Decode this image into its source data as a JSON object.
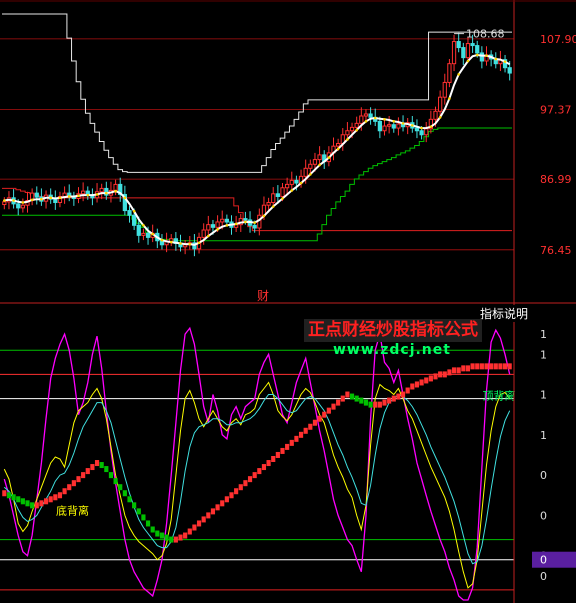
{
  "chart_data": [
    {
      "type": "line",
      "panel": "price",
      "y_ticks": [
        {
          "value": 107.9,
          "label": "107.90"
        },
        {
          "value": 97.37,
          "label": "97.37"
        },
        {
          "value": 86.99,
          "label": "86.99"
        },
        {
          "value": 76.45,
          "label": "76.45"
        }
      ],
      "ylim": [
        71.5,
        112.5
      ],
      "x_count": 110,
      "peak_annotation": {
        "index": 97,
        "value": 108.68,
        "label": "108.68"
      },
      "footer_label": "财",
      "colors": {
        "candle_up": "#ff3030",
        "candle_down": "#40e0e0",
        "ma_line": "#ffffff",
        "signal_dot": "#ffd700",
        "resistance": "#e02020",
        "support": "#00c000",
        "tick_text": "#ff3030"
      },
      "closes": [
        83.6,
        84.2,
        83.3,
        82.7,
        83.1,
        83.8,
        84.9,
        84.3,
        83.7,
        84.6,
        84.0,
        83.5,
        84.4,
        84.9,
        84.4,
        84.1,
        84.8,
        85.2,
        84.6,
        84.2,
        85.1,
        85.6,
        84.6,
        85.3,
        86.2,
        84.7,
        82.3,
        81.6,
        80.1,
        78.6,
        78.9,
        78.3,
        78.9,
        77.8,
        77.2,
        77.7,
        78.1,
        77.4,
        76.9,
        77.2,
        77.5,
        76.6,
        78.3,
        79.4,
        80.2,
        79.8,
        80.6,
        81.0,
        80.6,
        79.8,
        80.2,
        81.1,
        80.9,
        80.1,
        79.7,
        81.6,
        83.1,
        83.5,
        84.8,
        84.4,
        85.7,
        86.2,
        86.8,
        86.4,
        87.4,
        88.6,
        89.2,
        89.9,
        90.6,
        89.6,
        90.9,
        91.9,
        92.3,
        93.6,
        94.2,
        94.7,
        95.3,
        96.4,
        96.7,
        96.2,
        95.6,
        94.2,
        94.9,
        95.1,
        94.6,
        95.2,
        94.8,
        95.4,
        94.6,
        94.2,
        93.6,
        94.5,
        95.9,
        97.1,
        99.2,
        101.4,
        104.2,
        107.5,
        106.6,
        105.1,
        107.2,
        106.9,
        105.8,
        104.6,
        105.5,
        104.9,
        104.2,
        104.8,
        103.6,
        102.8
      ],
      "ma": [
        83.8,
        83.9,
        83.8,
        83.6,
        83.5,
        83.6,
        83.9,
        84.0,
        84.0,
        84.2,
        84.2,
        84.1,
        84.2,
        84.3,
        84.4,
        84.4,
        84.5,
        84.6,
        84.6,
        84.6,
        84.7,
        84.9,
        84.9,
        85.0,
        85.2,
        84.9,
        84.2,
        83.3,
        82.2,
        81.0,
        80.1,
        79.3,
        78.8,
        78.3,
        77.9,
        77.7,
        77.6,
        77.5,
        77.4,
        77.3,
        77.3,
        77.2,
        77.5,
        77.9,
        78.5,
        79.0,
        79.5,
        79.9,
        80.1,
        80.2,
        80.3,
        80.5,
        80.6,
        80.6,
        80.5,
        80.9,
        81.5,
        82.2,
        82.9,
        83.5,
        84.1,
        84.7,
        85.3,
        85.8,
        86.4,
        87.0,
        87.7,
        88.4,
        89.1,
        89.6,
        90.2,
        90.9,
        91.5,
        92.2,
        92.9,
        93.6,
        94.3,
        95.0,
        95.6,
        96.0,
        96.1,
        96.0,
        95.9,
        95.8,
        95.6,
        95.5,
        95.3,
        95.2,
        95.0,
        94.8,
        94.6,
        94.6,
        94.8,
        95.3,
        96.2,
        97.4,
        99.0,
        101.0,
        102.6,
        103.6,
        104.6,
        105.3,
        105.5,
        105.4,
        105.4,
        105.2,
        104.9,
        104.8,
        104.5,
        104.1
      ],
      "resistance": [
        85.6,
        85.6,
        85.6,
        85.4,
        85.2,
        85.0,
        84.8,
        84.6,
        84.4,
        84.2,
        84.2,
        84.2,
        84.2,
        84.2,
        84.2,
        84.2,
        84.2,
        84.2,
        84.2,
        84.2,
        84.2,
        84.2,
        84.2,
        84.2,
        84.2,
        84.2,
        84.2,
        84.2,
        84.2,
        84.2,
        84.2,
        84.2,
        84.2,
        84.2,
        84.2,
        84.2,
        84.2,
        84.2,
        84.2,
        84.2,
        84.2,
        84.2,
        84.2,
        84.2,
        84.2,
        84.2,
        84.2,
        84.2,
        84.2,
        84.2,
        83.0,
        82.0,
        80.8,
        79.9,
        79.3,
        79.3,
        79.3,
        79.3,
        79.3,
        79.3,
        79.3,
        79.3,
        79.3,
        79.3,
        79.3,
        79.3,
        79.3,
        79.3,
        79.3,
        79.3,
        79.3,
        79.3,
        79.3,
        79.3,
        79.3,
        79.3,
        79.3,
        79.3,
        79.3,
        79.3,
        79.3,
        79.3,
        79.3,
        79.3,
        79.3,
        79.3,
        79.3,
        79.3,
        79.3,
        79.3,
        79.3,
        79.3,
        79.3,
        79.3,
        79.3,
        79.3,
        79.3,
        79.3,
        79.3,
        79.3,
        79.3,
        79.3,
        79.3,
        79.3,
        79.3,
        79.3,
        79.3,
        79.3,
        79.3,
        79.3
      ],
      "support": [
        81.6,
        81.6,
        81.6,
        81.6,
        81.6,
        81.6,
        81.6,
        81.6,
        81.6,
        81.6,
        81.6,
        81.6,
        81.6,
        81.6,
        81.6,
        81.6,
        81.6,
        81.6,
        81.6,
        81.6,
        81.6,
        81.6,
        81.6,
        81.6,
        81.6,
        81.6,
        81.6,
        81.6,
        81.0,
        80.4,
        79.8,
        79.0,
        78.4,
        78.2,
        78.0,
        78.0,
        78.0,
        77.8,
        77.8,
        77.8,
        77.8,
        77.8,
        77.8,
        77.8,
        77.8,
        77.8,
        77.8,
        77.8,
        77.8,
        77.8,
        77.8,
        77.8,
        77.8,
        77.8,
        77.8,
        77.8,
        77.8,
        77.8,
        77.8,
        77.8,
        77.8,
        77.8,
        77.8,
        77.8,
        77.8,
        77.8,
        77.8,
        77.8,
        78.8,
        80.2,
        81.6,
        82.6,
        83.6,
        84.4,
        85.2,
        86.2,
        87.0,
        87.6,
        88.1,
        88.6,
        89.0,
        89.3,
        89.6,
        89.9,
        90.2,
        90.6,
        90.9,
        91.2,
        91.6,
        92.0,
        92.6,
        93.3,
        94.1,
        94.4,
        94.6,
        94.6,
        94.6,
        94.6,
        94.6,
        94.6,
        94.6,
        94.6,
        94.6,
        94.6,
        94.6,
        94.6,
        94.6,
        94.6,
        94.6,
        94.6
      ],
      "upper_envelope": [
        111.6,
        111.6,
        111.6,
        111.6,
        111.6,
        111.6,
        111.6,
        111.6,
        111.6,
        111.6,
        111.6,
        111.6,
        111.6,
        111.6,
        108.0,
        104.6,
        101.5,
        98.9,
        96.8,
        95.3,
        94.0,
        92.6,
        91.3,
        90.2,
        89.2,
        88.4,
        88.1,
        88.0,
        88.0,
        88.0,
        88.0,
        88.0,
        88.0,
        88.0,
        88.0,
        88.0,
        88.0,
        88.0,
        88.0,
        88.0,
        88.0,
        88.0,
        88.0,
        88.0,
        88.0,
        88.0,
        88.0,
        88.0,
        88.0,
        88.0,
        88.0,
        88.0,
        88.0,
        88.0,
        88.0,
        88.0,
        89.0,
        90.2,
        91.4,
        92.3,
        93.1,
        94.0,
        94.9,
        95.9,
        97.0,
        98.2,
        98.8,
        98.8,
        98.8,
        98.8,
        98.8,
        98.8,
        98.8,
        98.8,
        98.8,
        98.8,
        98.8,
        98.8,
        98.8,
        98.8,
        98.8,
        98.8,
        98.8,
        98.8,
        98.8,
        98.8,
        98.8,
        98.8,
        98.8,
        98.8,
        98.8,
        98.8,
        108.9,
        108.9,
        108.9,
        108.9,
        108.9,
        108.9,
        108.9,
        108.9,
        108.9,
        108.9,
        108.9,
        108.9,
        108.9,
        108.9,
        108.9,
        108.9,
        108.9,
        108.9
      ]
    },
    {
      "type": "line",
      "panel": "indicator",
      "badge_label": "指标说明",
      "watermark_title": "正点财经炒股指标公式",
      "watermark_url": "www.zdcj.net",
      "annotations": [
        {
          "label": "底背离",
          "index": 12,
          "value": 0.13
        },
        {
          "label": "顶背离",
          "index": 104,
          "value": 0.7
        }
      ],
      "y_ticks": [
        {
          "value": 1.0,
          "label": "1"
        },
        {
          "value": 0.9,
          "label": "1"
        },
        {
          "value": 0.7,
          "label": "1"
        },
        {
          "value": 0.5,
          "label": "1"
        },
        {
          "value": 0.3,
          "label": "0"
        },
        {
          "value": 0.1,
          "label": "0"
        },
        {
          "value": -0.1,
          "label": "0"
        },
        {
          "value": -0.2,
          "label": "0"
        }
      ],
      "current_marker": {
        "value": -0.12,
        "label": "0"
      },
      "ylim": [
        -0.32,
        1.08
      ],
      "reference_lines": [
        {
          "value": 0.92,
          "color": "#00c000"
        },
        {
          "value": 0.8,
          "color": "#ff3030"
        },
        {
          "value": 0.68,
          "color": "#ffffff"
        },
        {
          "value": -0.02,
          "color": "#00c000"
        },
        {
          "value": -0.12,
          "color": "#ffffff"
        },
        {
          "value": -0.27,
          "color": "#e02020"
        }
      ],
      "colors": {
        "k": "#ffff00",
        "d": "#40e0e0",
        "j": "#ff00ff",
        "trend_up": "#ff3030",
        "trend_down": "#00c000"
      },
      "k": [
        0.33,
        0.28,
        0.18,
        0.06,
        0.02,
        0.05,
        0.12,
        0.18,
        0.24,
        0.3,
        0.36,
        0.39,
        0.38,
        0.34,
        0.45,
        0.56,
        0.62,
        0.64,
        0.66,
        0.7,
        0.73,
        0.68,
        0.58,
        0.44,
        0.3,
        0.2,
        0.1,
        0.04,
        0.0,
        -0.03,
        -0.05,
        -0.07,
        -0.09,
        -0.12,
        -0.1,
        -0.04,
        0.08,
        0.3,
        0.52,
        0.68,
        0.72,
        0.66,
        0.58,
        0.54,
        0.58,
        0.62,
        0.58,
        0.54,
        0.52,
        0.56,
        0.58,
        0.55,
        0.6,
        0.61,
        0.63,
        0.7,
        0.73,
        0.76,
        0.7,
        0.62,
        0.59,
        0.57,
        0.6,
        0.65,
        0.7,
        0.73,
        0.71,
        0.66,
        0.6,
        0.56,
        0.48,
        0.4,
        0.34,
        0.29,
        0.23,
        0.19,
        0.1,
        0.03,
        0.15,
        0.45,
        0.68,
        0.75,
        0.73,
        0.72,
        0.7,
        0.73,
        0.68,
        0.62,
        0.58,
        0.52,
        0.46,
        0.4,
        0.34,
        0.29,
        0.24,
        0.19,
        0.12,
        0.03,
        -0.08,
        -0.18,
        -0.26,
        -0.24,
        -0.12,
        0.12,
        0.35,
        0.52,
        0.64,
        0.7,
        0.71,
        0.68
      ],
      "d": [
        0.24,
        0.22,
        0.18,
        0.13,
        0.09,
        0.07,
        0.08,
        0.1,
        0.14,
        0.18,
        0.22,
        0.27,
        0.3,
        0.31,
        0.35,
        0.41,
        0.48,
        0.54,
        0.58,
        0.62,
        0.66,
        0.66,
        0.62,
        0.56,
        0.47,
        0.38,
        0.29,
        0.21,
        0.14,
        0.08,
        0.04,
        0.01,
        -0.02,
        -0.05,
        -0.06,
        -0.06,
        -0.03,
        0.04,
        0.17,
        0.32,
        0.44,
        0.51,
        0.54,
        0.55,
        0.56,
        0.58,
        0.58,
        0.57,
        0.55,
        0.55,
        0.56,
        0.56,
        0.57,
        0.58,
        0.6,
        0.63,
        0.67,
        0.7,
        0.7,
        0.68,
        0.65,
        0.62,
        0.61,
        0.62,
        0.65,
        0.68,
        0.69,
        0.68,
        0.65,
        0.62,
        0.57,
        0.51,
        0.45,
        0.4,
        0.34,
        0.29,
        0.23,
        0.16,
        0.15,
        0.25,
        0.4,
        0.53,
        0.61,
        0.66,
        0.68,
        0.7,
        0.69,
        0.67,
        0.64,
        0.6,
        0.55,
        0.5,
        0.44,
        0.39,
        0.34,
        0.29,
        0.23,
        0.17,
        0.09,
        0.0,
        -0.09,
        -0.14,
        -0.13,
        -0.05,
        0.08,
        0.23,
        0.37,
        0.49,
        0.57,
        0.62
      ],
      "j": [
        0.28,
        0.2,
        0.1,
        0.0,
        -0.08,
        -0.1,
        0.0,
        0.18,
        0.36,
        0.58,
        0.78,
        0.88,
        0.95,
        1.0,
        0.92,
        0.78,
        0.6,
        0.66,
        0.76,
        0.9,
        0.99,
        0.83,
        0.62,
        0.42,
        0.26,
        0.12,
        -0.02,
        -0.12,
        -0.18,
        -0.22,
        -0.26,
        -0.28,
        -0.3,
        -0.22,
        -0.12,
        0.06,
        0.3,
        0.56,
        0.82,
        1.0,
        1.03,
        0.95,
        0.8,
        0.64,
        0.56,
        0.7,
        0.62,
        0.5,
        0.48,
        0.6,
        0.64,
        0.58,
        0.64,
        0.66,
        0.68,
        0.8,
        0.86,
        0.9,
        0.8,
        0.7,
        0.6,
        0.56,
        0.66,
        0.76,
        0.82,
        0.88,
        0.76,
        0.64,
        0.52,
        0.42,
        0.3,
        0.18,
        0.1,
        0.04,
        -0.02,
        -0.05,
        -0.12,
        -0.18,
        0.1,
        0.58,
        0.92,
        1.0,
        0.86,
        0.83,
        0.76,
        0.82,
        0.7,
        0.58,
        0.48,
        0.36,
        0.28,
        0.2,
        0.12,
        0.05,
        -0.02,
        -0.08,
        -0.16,
        -0.22,
        -0.3,
        -0.32,
        -0.32,
        -0.26,
        -0.06,
        0.34,
        0.72,
        0.96,
        1.02,
        0.98,
        0.9,
        0.8
      ],
      "trend_line": [
        0.21,
        0.2,
        0.19,
        0.18,
        0.17,
        0.16,
        0.15,
        0.15,
        0.16,
        0.17,
        0.18,
        0.19,
        0.2,
        0.22,
        0.24,
        0.26,
        0.28,
        0.3,
        0.32,
        0.34,
        0.36,
        0.35,
        0.33,
        0.3,
        0.27,
        0.24,
        0.21,
        0.18,
        0.15,
        0.12,
        0.09,
        0.06,
        0.03,
        0.01,
        0.0,
        -0.01,
        -0.02,
        -0.02,
        -0.01,
        0.0,
        0.02,
        0.04,
        0.06,
        0.08,
        0.1,
        0.12,
        0.14,
        0.16,
        0.18,
        0.2,
        0.22,
        0.24,
        0.26,
        0.28,
        0.3,
        0.32,
        0.34,
        0.36,
        0.38,
        0.4,
        0.42,
        0.44,
        0.46,
        0.48,
        0.5,
        0.52,
        0.54,
        0.56,
        0.58,
        0.6,
        0.62,
        0.64,
        0.66,
        0.68,
        0.7,
        0.69,
        0.68,
        0.67,
        0.66,
        0.65,
        0.65,
        0.65,
        0.66,
        0.67,
        0.68,
        0.69,
        0.7,
        0.72,
        0.74,
        0.75,
        0.76,
        0.77,
        0.78,
        0.79,
        0.8,
        0.8,
        0.81,
        0.82,
        0.82,
        0.83,
        0.83,
        0.84,
        0.84,
        0.84,
        0.84,
        0.84,
        0.84,
        0.84,
        0.84,
        0.84
      ]
    }
  ]
}
